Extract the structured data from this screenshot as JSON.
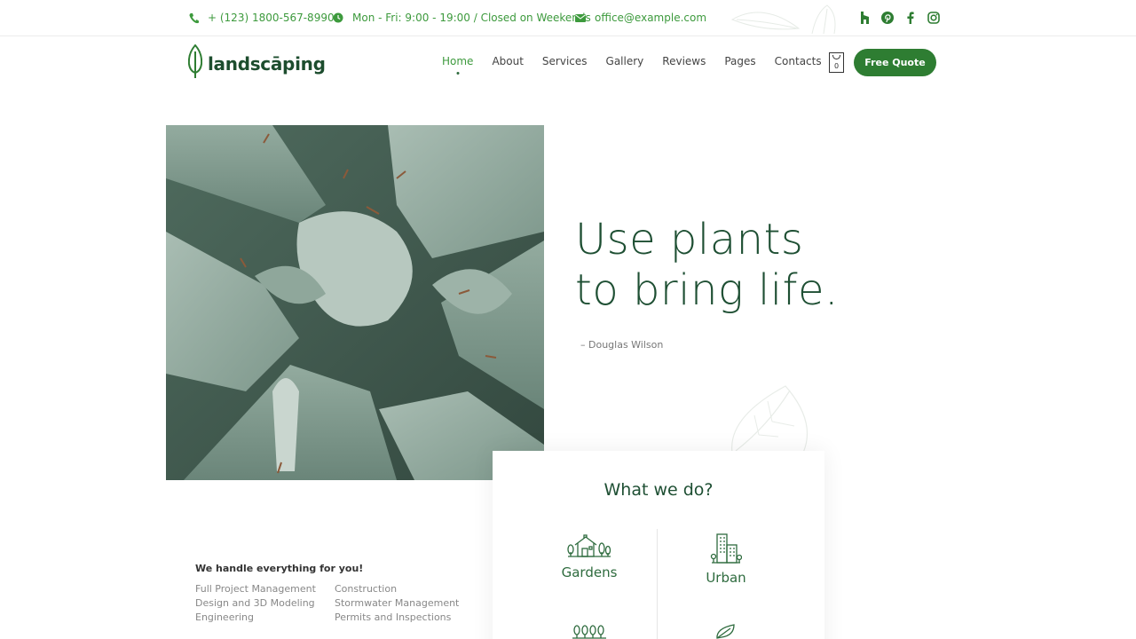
{
  "topbar": {
    "phone": "+ (123) 1800-567-8990",
    "hours": "Mon - Fri: 9:00 - 19:00 / Closed on Weekends",
    "email": "office@example.com",
    "socials": [
      "houzz-icon",
      "pinterest-icon",
      "facebook-icon",
      "instagram-icon"
    ]
  },
  "header": {
    "logo_text": "landscāping",
    "nav": [
      {
        "label": "Home",
        "active": true
      },
      {
        "label": "About"
      },
      {
        "label": "Services"
      },
      {
        "label": "Gallery"
      },
      {
        "label": "Reviews"
      },
      {
        "label": "Pages"
      },
      {
        "label": "Contacts"
      }
    ],
    "cart_count": "0",
    "cta_label": "Free Quote"
  },
  "hero": {
    "title": "Use plants\nto bring life.",
    "author": "– Douglas Wilson"
  },
  "features": {
    "title": "We handle everything for you!",
    "col1": [
      "Full Project Management",
      "Design and 3D Modeling",
      "Engineering"
    ],
    "col2": [
      "Construction",
      "Stormwater Management",
      "Permits and Inspections"
    ]
  },
  "what_we_do": {
    "title": "What we do?",
    "services": [
      {
        "label": "Gardens",
        "icon": "house-garden-icon"
      },
      {
        "label": "Urban",
        "icon": "building-icon"
      },
      {
        "label": "",
        "icon": "trees-icon"
      },
      {
        "label": "",
        "icon": "leaf-icon"
      }
    ]
  },
  "colors": {
    "brand_green": "#2e7d32",
    "dark_green": "#1e4f33",
    "accent_green": "#3d9a3d"
  }
}
